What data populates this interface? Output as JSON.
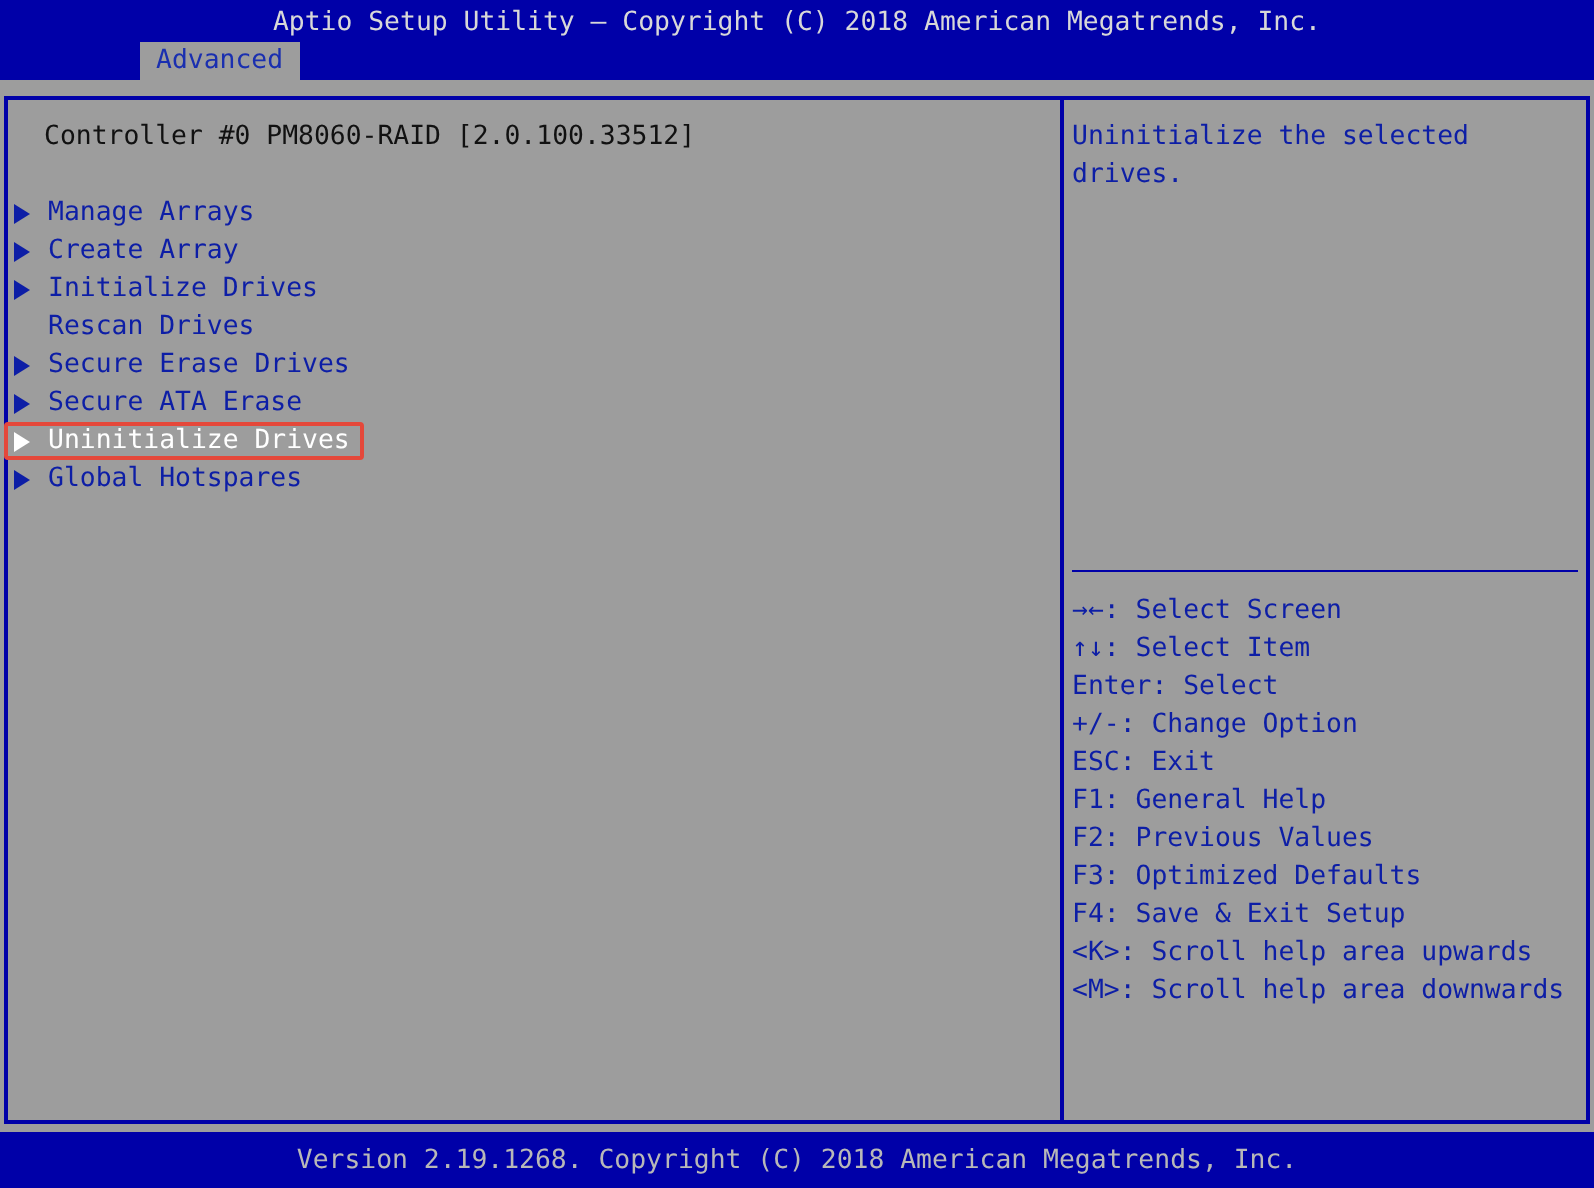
{
  "header": {
    "title": "Aptio Setup Utility – Copyright (C) 2018 American Megatrends, Inc.",
    "tabs": [
      {
        "label": "Advanced",
        "selected": true
      }
    ]
  },
  "main": {
    "heading": "Controller #0 PM8060-RAID [2.0.100.33512]",
    "items": [
      {
        "label": "Manage Arrays",
        "submenu": true,
        "selected": false
      },
      {
        "label": "Create Array",
        "submenu": true,
        "selected": false
      },
      {
        "label": "Initialize Drives",
        "submenu": true,
        "selected": false
      },
      {
        "label": "Rescan Drives",
        "submenu": false,
        "selected": false
      },
      {
        "label": "Secure Erase Drives",
        "submenu": true,
        "selected": false
      },
      {
        "label": "Secure ATA Erase",
        "submenu": true,
        "selected": false
      },
      {
        "label": "Uninitialize Drives",
        "submenu": true,
        "selected": true
      },
      {
        "label": "Global Hotspares",
        "submenu": true,
        "selected": false
      }
    ]
  },
  "help": {
    "text": "Uninitialize the selected drives.",
    "keys": [
      "→←: Select Screen",
      "↑↓: Select Item",
      "Enter: Select",
      "+/-: Change Option",
      "ESC: Exit",
      "F1: General Help",
      "F2: Previous Values",
      "F3: Optimized Defaults",
      "F4: Save & Exit Setup",
      "<K>: Scroll help area upwards",
      "<M>: Scroll help area downwards"
    ]
  },
  "footer": {
    "text": "Version 2.19.1268. Copyright (C) 2018 American Megatrends, Inc."
  }
}
